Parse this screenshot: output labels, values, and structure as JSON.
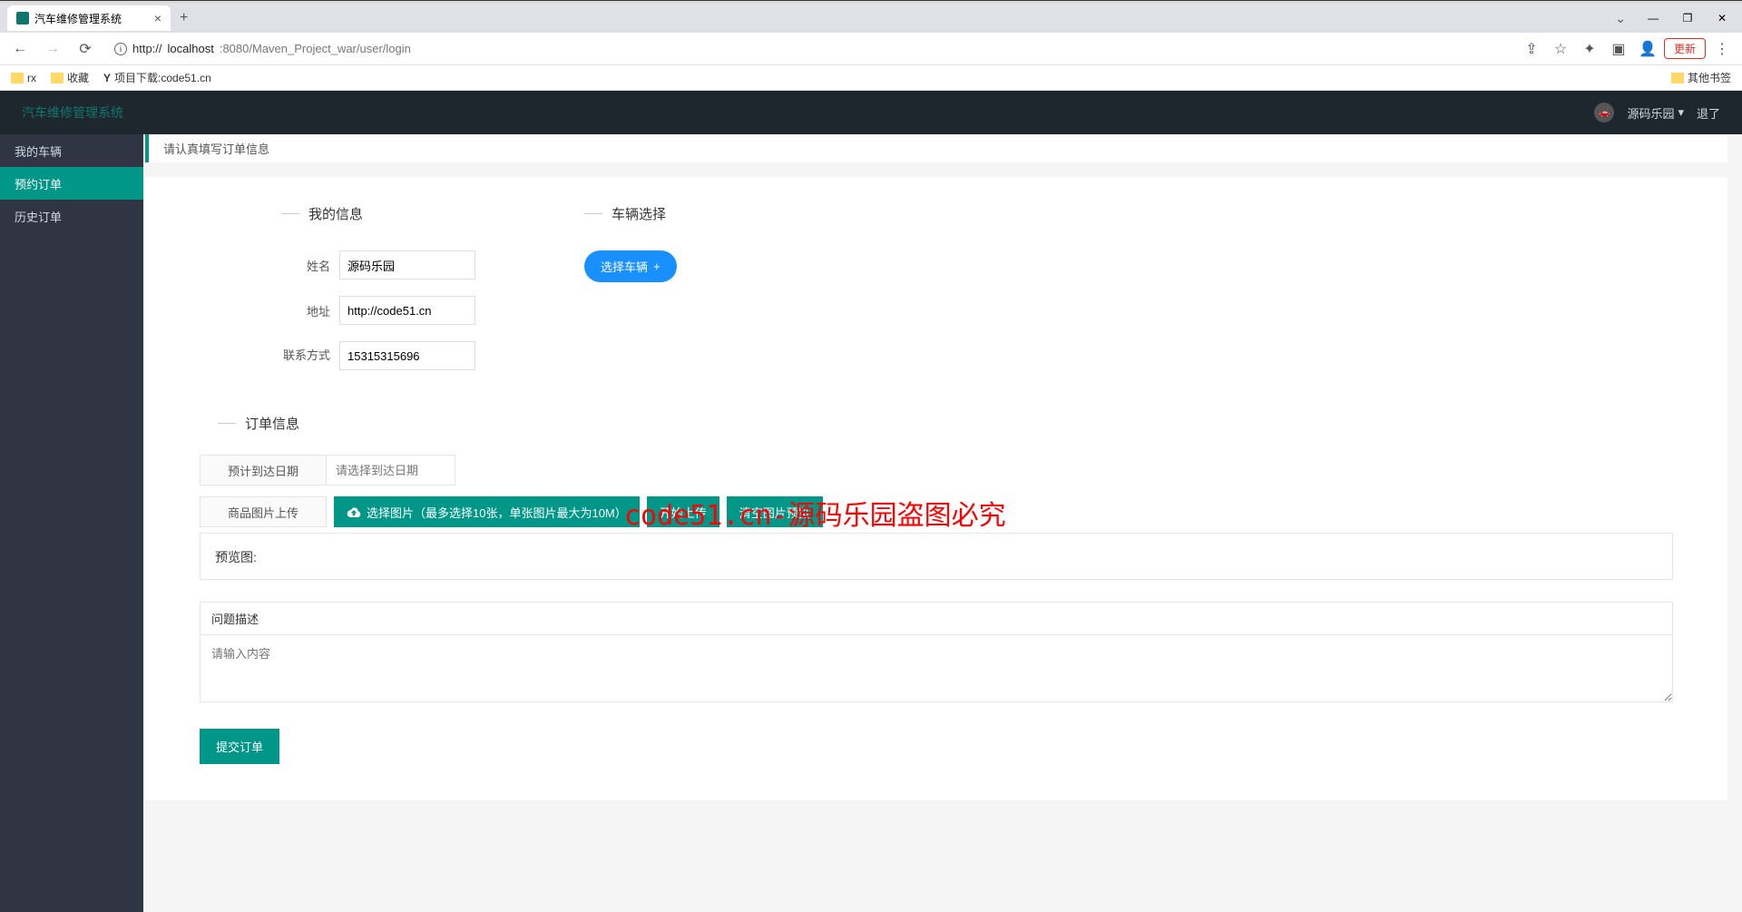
{
  "browser": {
    "tab_title": "汽车维修管理系统",
    "url_prefix": "http://",
    "url_host": "localhost",
    "url_port_path": ":8080/Maven_Project_war/user/login",
    "update_label": "更新",
    "bookmarks": {
      "rx": "rx",
      "fav": "收藏",
      "proj": "项目下载:code51.cn",
      "other": "其他书签"
    }
  },
  "header": {
    "app_title": "汽车维修管理系统",
    "username": "源码乐园",
    "logout": "退了"
  },
  "sidebar": {
    "items": [
      {
        "label": "我的车辆"
      },
      {
        "label": "预约订单"
      },
      {
        "label": "历史订单"
      }
    ]
  },
  "notice": "请认真填写订单信息",
  "sections": {
    "my_info": "我的信息",
    "vehicle": "车辆选择",
    "order_info": "订单信息"
  },
  "form": {
    "name_label": "姓名",
    "name_value": "源码乐园",
    "addr_label": "地址",
    "addr_value": "http://code51.cn",
    "contact_label": "联系方式",
    "contact_value": "15315315696",
    "vehicle_btn": "选择车辆",
    "date_label": "预计到达日期",
    "date_placeholder": "请选择到达日期",
    "img_label": "商品图片上传",
    "select_img": "选择图片（最多选择10张，单张图片最大为10M）",
    "start_upload": "开始上传",
    "clear_preview": "清空图片预览",
    "preview_label": "预览图:",
    "desc_label": "问题描述",
    "desc_placeholder": "请输入内容",
    "submit": "提交订单"
  },
  "watermark": "code51.cn-源码乐园盗图必究"
}
